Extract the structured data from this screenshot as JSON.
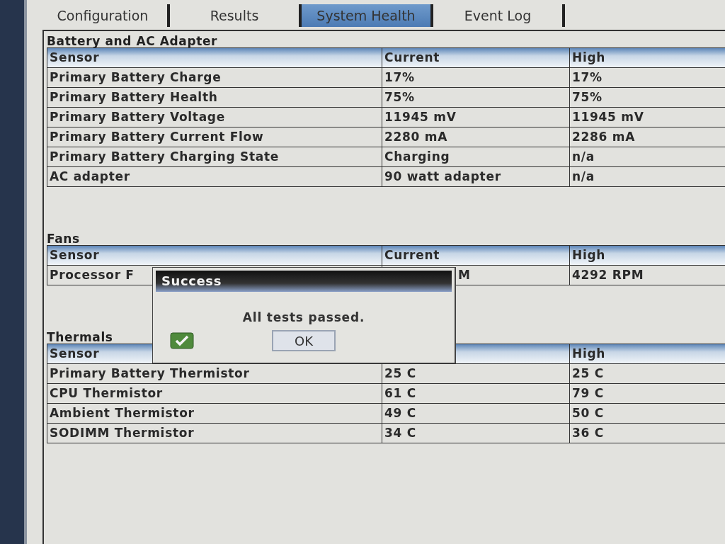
{
  "tabs": [
    {
      "label": "Configuration",
      "selected": false
    },
    {
      "label": "Results",
      "selected": false
    },
    {
      "label": "System Health",
      "selected": true
    },
    {
      "label": "Event Log",
      "selected": false
    }
  ],
  "sections": [
    {
      "title": "Battery and AC Adapter",
      "columns": [
        "Sensor",
        "Current",
        "High"
      ],
      "rows": [
        {
          "cells": [
            "Primary Battery Charge",
            "17%",
            "17%"
          ]
        },
        {
          "cells": [
            "Primary Battery Health",
            "75%",
            "75%"
          ]
        },
        {
          "cells": [
            "Primary Battery Voltage",
            "11945 mV",
            "11945 mV"
          ]
        },
        {
          "cells": [
            "Primary Battery Current Flow",
            "2280 mA",
            "2286 mA"
          ]
        },
        {
          "cells": [
            "Primary Battery Charging State",
            "Charging",
            "n/a"
          ]
        },
        {
          "cells": [
            "AC adapter",
            "90 watt adapter",
            "n/a"
          ]
        }
      ]
    },
    {
      "title": "Fans",
      "columns": [
        "Sensor",
        "Current",
        "High"
      ],
      "rows": [
        {
          "cells": [
            "Processor F",
            "M",
            "4292 RPM"
          ],
          "covered": true
        }
      ]
    },
    {
      "title": "Thermals",
      "columns": [
        "Sensor",
        null,
        "High"
      ],
      "rows": [
        {
          "cells": [
            "Primary Battery Thermistor",
            "25 C",
            "25 C"
          ]
        },
        {
          "cells": [
            "CPU Thermistor",
            "61 C",
            "79 C"
          ]
        },
        {
          "cells": [
            "Ambient Thermistor",
            "49 C",
            "50 C"
          ]
        },
        {
          "cells": [
            "SODIMM Thermistor",
            "34 C",
            "36 C"
          ]
        }
      ]
    }
  ],
  "dialog": {
    "title": "Success",
    "message": "All tests passed.",
    "button": "OK"
  }
}
